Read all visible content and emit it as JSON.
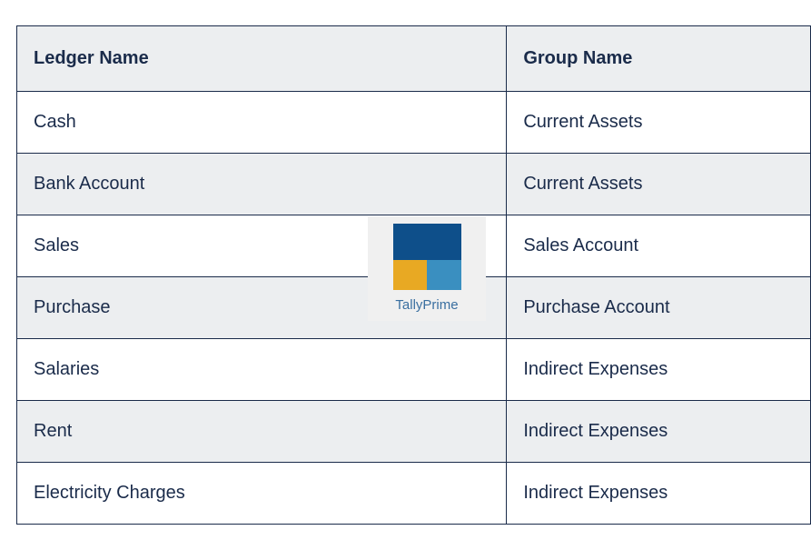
{
  "table": {
    "headers": [
      "Ledger Name",
      "Group Name"
    ],
    "rows": [
      {
        "ledger": "Cash",
        "group": "Current Assets"
      },
      {
        "ledger": "Bank Account",
        "group": "Current Assets"
      },
      {
        "ledger": "Sales",
        "group": "Sales Account"
      },
      {
        "ledger": "Purchase",
        "group": "Purchase Account"
      },
      {
        "ledger": "Salaries",
        "group": "Indirect Expenses"
      },
      {
        "ledger": "Rent",
        "group": "Indirect Expenses"
      },
      {
        "ledger": "Electricity Charges",
        "group": "Indirect Expenses"
      }
    ]
  },
  "watermark": {
    "label": "TallyPrime"
  }
}
